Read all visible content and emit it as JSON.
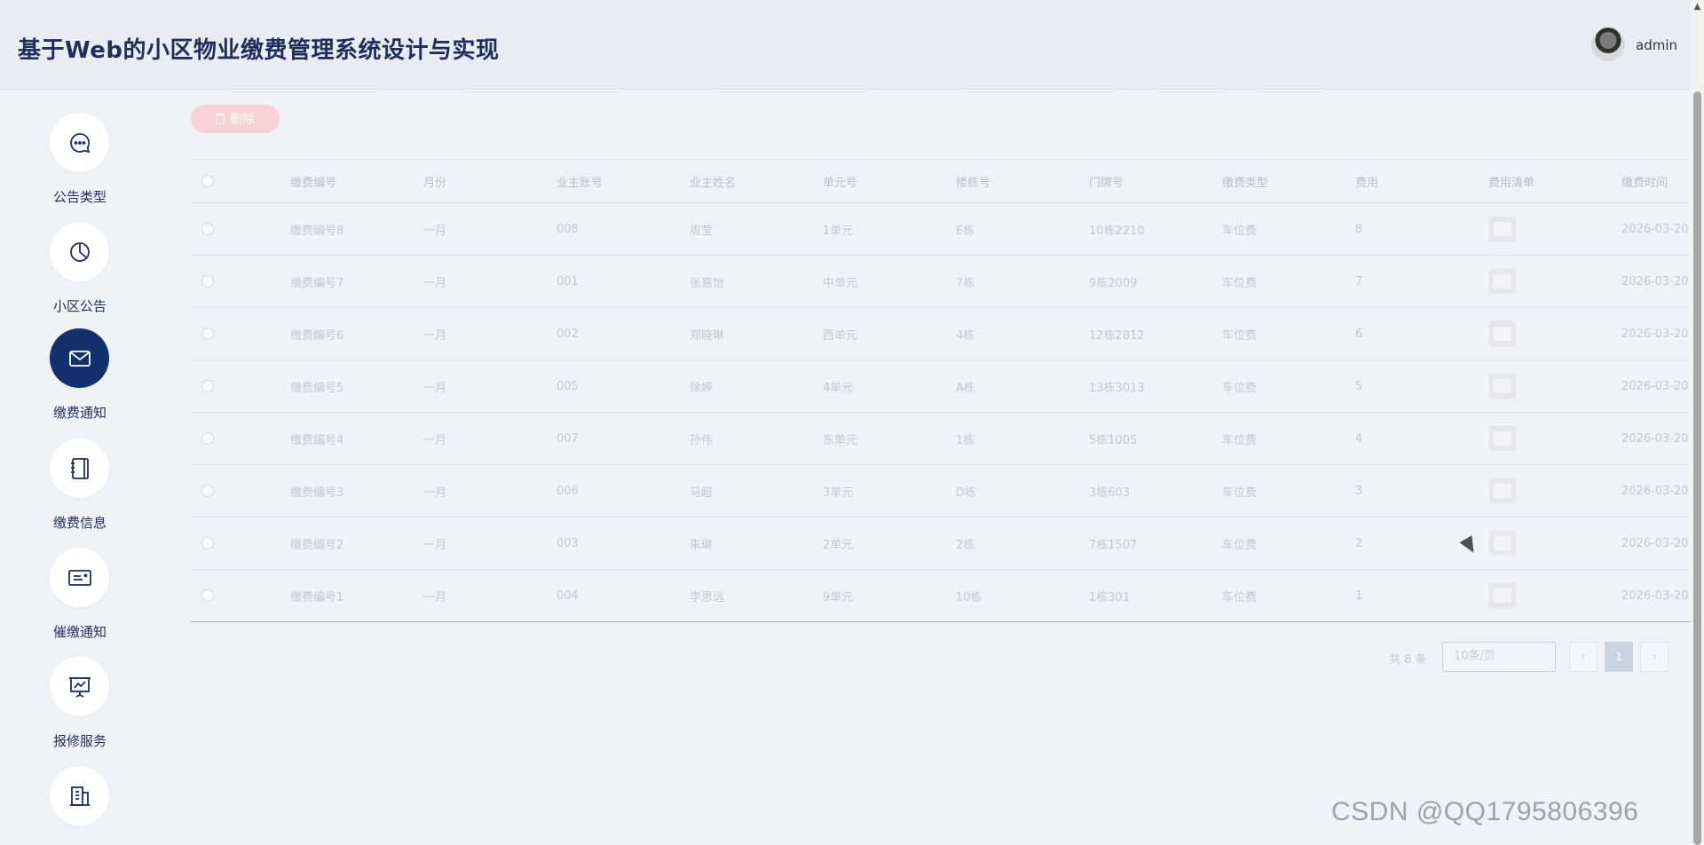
{
  "header": {
    "title": "基于Web的小区物业缴费管理系统设计与实现",
    "username": "admin"
  },
  "sidebar": {
    "items": [
      {
        "label": "公告类型",
        "icon": "chat-bubble-icon",
        "active": false
      },
      {
        "label": "小区公告",
        "icon": "pie-chart-icon",
        "active": false
      },
      {
        "label": "缴费通知",
        "icon": "envelope-icon",
        "active": true
      },
      {
        "label": "缴费信息",
        "icon": "notebook-icon",
        "active": false
      },
      {
        "label": "催缴通知",
        "icon": "id-card-icon",
        "active": false
      },
      {
        "label": "报修服务",
        "icon": "presentation-chart-icon",
        "active": false
      },
      {
        "label": "",
        "icon": "building-icon",
        "active": false
      }
    ]
  },
  "toolbar": {
    "delete_label": "删除"
  },
  "table": {
    "columns": [
      "缴费编号",
      "月份",
      "业主账号",
      "业主姓名",
      "单元号",
      "楼栋号",
      "门牌号",
      "缴费类型",
      "费用",
      "费用清单",
      "缴费时间"
    ],
    "rows": [
      [
        "缴费编号8",
        "一月",
        "008",
        "周莹",
        "1单元",
        "E栋",
        "10栋2210",
        "车位费",
        "8",
        "",
        "2026-03-20"
      ],
      [
        "缴费编号7",
        "一月",
        "001",
        "张嘉怡",
        "中单元",
        "7栋",
        "9栋2009",
        "车位费",
        "7",
        "",
        "2026-03-20"
      ],
      [
        "缴费编号6",
        "一月",
        "002",
        "郑晓琳",
        "西单元",
        "4栋",
        "12栋2812",
        "车位费",
        "6",
        "",
        "2026-03-20"
      ],
      [
        "缴费编号5",
        "一月",
        "005",
        "徐婷",
        "4单元",
        "A栋",
        "13栋3013",
        "车位费",
        "5",
        "",
        "2026-03-20"
      ],
      [
        "缴费编号4",
        "一月",
        "007",
        "孙伟",
        "东单元",
        "1栋",
        "5栋1005",
        "车位费",
        "4",
        "",
        "2026-03-20"
      ],
      [
        "缴费编号3",
        "一月",
        "006",
        "马超",
        "3单元",
        "D栋",
        "3栋603",
        "车位费",
        "3",
        "",
        "2026-03-20"
      ],
      [
        "缴费编号2",
        "一月",
        "003",
        "朱琳",
        "2单元",
        "2栋",
        "7栋1507",
        "车位费",
        "2",
        "",
        "2026-03-20"
      ],
      [
        "缴费编号1",
        "一月",
        "004",
        "李思远",
        "9单元",
        "10栋",
        "1栋301",
        "车位费",
        "1",
        "",
        "2026-03-20"
      ]
    ]
  },
  "pagination": {
    "total": "共 8 条",
    "page_size": "10条/页",
    "prev": "‹",
    "current": "1",
    "next": "›"
  },
  "watermark": "CSDN @QQ1795806396"
}
